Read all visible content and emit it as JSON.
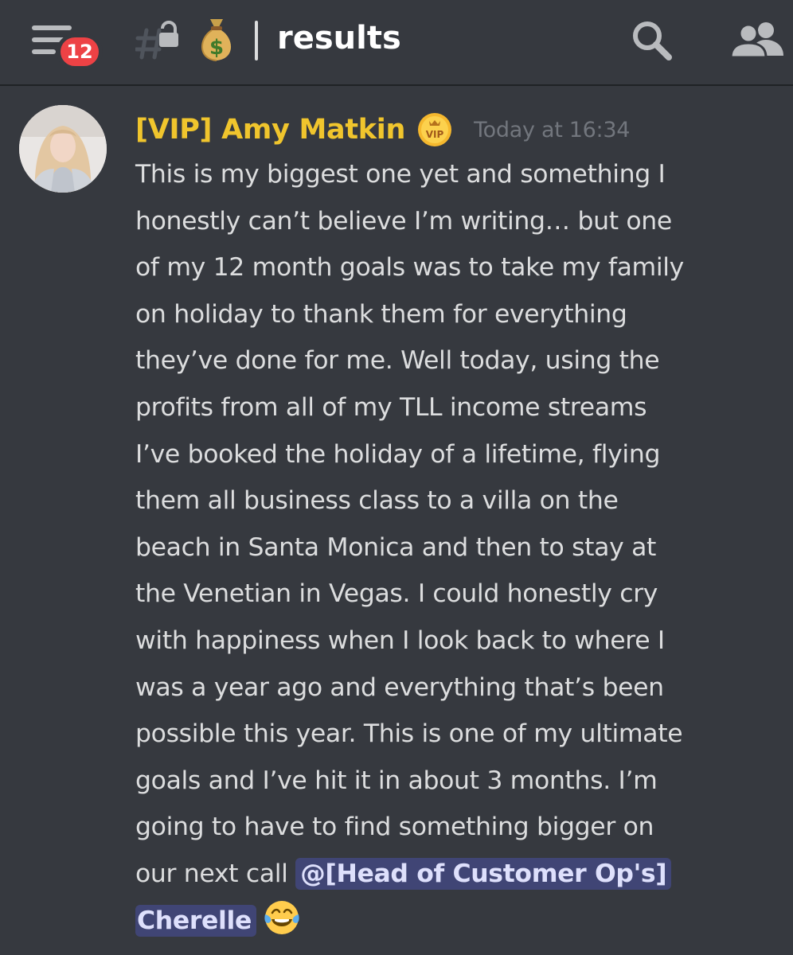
{
  "header": {
    "notification_count": "12",
    "channel_icon": "hashtag-lock-icon",
    "channel_emoji": "money-bag-icon",
    "channel_name": "results",
    "actions": [
      "search-icon",
      "members-icon"
    ]
  },
  "message": {
    "author": "[VIP] Amy Matkin",
    "role_badge": "VIP",
    "author_color": "#f0c52d",
    "timestamp": "Today at 16:34",
    "lines": [
      "This is my biggest one yet and something I",
      "honestly can’t believe I’m writing… but one",
      "of my 12 month goals was to take my family",
      "on holiday to thank them for everything",
      "they’ve done for me. Well today, using the",
      "profits from all of my TLL income streams",
      "I’ve booked the holiday of a lifetime, flying",
      "them all business class to a villa on the",
      "beach in Santa Monica and then to stay at",
      "the Venetian in Vegas. I could honestly cry",
      "with happiness when I look back to where I",
      "was a year ago and everything that’s been",
      "possible this year. This is one of my ultimate",
      "goals and I’ve hit it in about 3 months. I’m",
      "going to have to find something bigger on"
    ],
    "last_line_prefix": "our next call ",
    "mention_part1": "@[Head of Customer Op's]",
    "mention_part2": "Cherelle",
    "trailing_emoji": "face-with-tears-of-joy-icon"
  },
  "colors": {
    "background": "#36393f",
    "mention_bg": "#4b4f7a",
    "badge_red": "#ed4245",
    "text": "#dcddde"
  }
}
